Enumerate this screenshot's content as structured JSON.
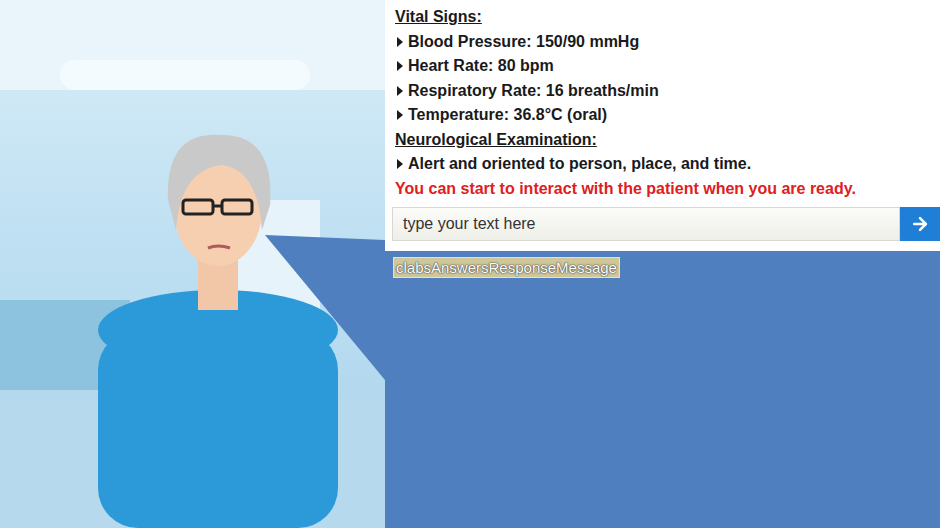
{
  "vitals": {
    "heading": "Vital Signs:",
    "items": [
      "Blood Pressure: 150/90 mmHg",
      "Heart Rate: 80 bpm",
      "Respiratory Rate: 16 breaths/min",
      "Temperature: 36.8°C (oral)"
    ]
  },
  "neuro": {
    "heading": "Neurological Examination:",
    "items": [
      "Alert and oriented to person, place, and time."
    ]
  },
  "prompt": "You can start to interact with the patient when you are ready.",
  "input": {
    "placeholder": "type your text here"
  },
  "response": "clabsAnswersResponseMessage"
}
